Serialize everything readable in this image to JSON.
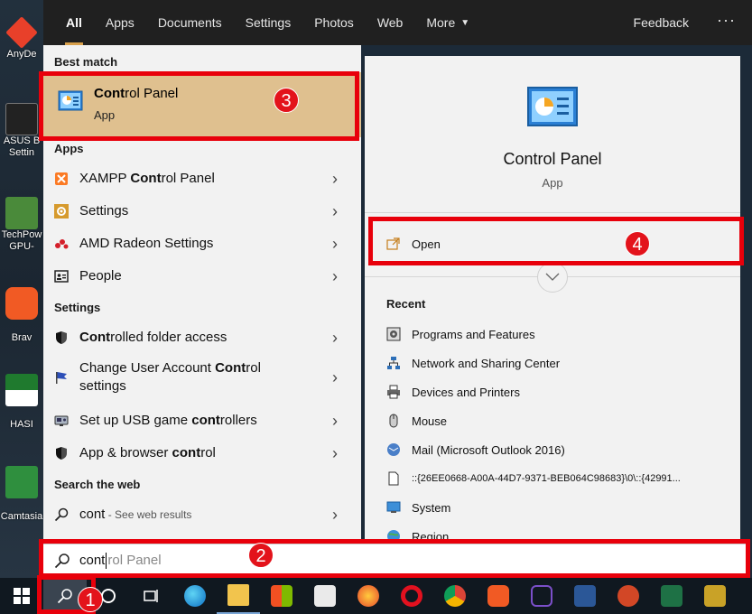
{
  "desktop": {
    "icons": [
      {
        "label": "AnyDe"
      },
      {
        "label": "ASUS B"
      },
      {
        "label": "Settin"
      },
      {
        "label": "TechPow"
      },
      {
        "label": "GPU-"
      },
      {
        "label": "Brav"
      },
      {
        "label": "HASI"
      },
      {
        "label": "Camtasia"
      }
    ]
  },
  "tabs": [
    {
      "label": "All"
    },
    {
      "label": "Apps"
    },
    {
      "label": "Documents"
    },
    {
      "label": "Settings"
    },
    {
      "label": "Photos"
    },
    {
      "label": "Web"
    },
    {
      "label": "More"
    }
  ],
  "topbar": {
    "feedback": "Feedback",
    "more_dots": "···"
  },
  "left": {
    "best_match_heading": "Best match",
    "best_match": {
      "title_bold": "Cont",
      "title_rest": "rol Panel",
      "subtitle": "App"
    },
    "apps_heading": "Apps",
    "apps": [
      {
        "pre": "XAMPP ",
        "bold": "Cont",
        "post": "rol Panel"
      },
      {
        "pre": "Settings",
        "bold": "",
        "post": ""
      },
      {
        "pre": "AMD Radeon Settings",
        "bold": "",
        "post": ""
      },
      {
        "pre": "People",
        "bold": "",
        "post": ""
      }
    ],
    "settings_heading": "Settings",
    "settings": [
      {
        "pre": "",
        "bold": "Cont",
        "post": "rolled folder access"
      },
      {
        "pre": "Change User Account ",
        "bold": "Cont",
        "post": "rol",
        "line2": "settings"
      },
      {
        "pre": "Set up USB game ",
        "bold": "cont",
        "post": "rollers"
      },
      {
        "pre": "App & browser ",
        "bold": "cont",
        "post": "rol"
      }
    ],
    "web_heading": "Search the web",
    "web": {
      "query": "cont",
      "hint": " - See web results"
    }
  },
  "right": {
    "title": "Control Panel",
    "subtitle": "App",
    "open_label": "Open",
    "recent_heading": "Recent",
    "recent": [
      {
        "label": "Programs and Features",
        "icon": "programs-features-icon"
      },
      {
        "label": "Network and Sharing Center",
        "icon": "network-icon"
      },
      {
        "label": "Devices and Printers",
        "icon": "printer-icon"
      },
      {
        "label": "Mouse",
        "icon": "mouse-icon"
      },
      {
        "label": "Mail (Microsoft Outlook 2016)",
        "icon": "mail-icon"
      },
      {
        "label": "::{26EE0668-A00A-44D7-9371-BEB064C98683}\\0\\::{42991...",
        "icon": "file-icon"
      },
      {
        "label": "System",
        "icon": "system-icon"
      },
      {
        "label": "Region",
        "icon": "region-icon"
      }
    ]
  },
  "search": {
    "typed": "cont",
    "ghost": "rol Panel"
  },
  "annotations": [
    "1",
    "2",
    "3",
    "4"
  ],
  "colors": {
    "accent": "#d8a04b",
    "highlight": "#dfc08f",
    "annotation": "#e8000b"
  }
}
